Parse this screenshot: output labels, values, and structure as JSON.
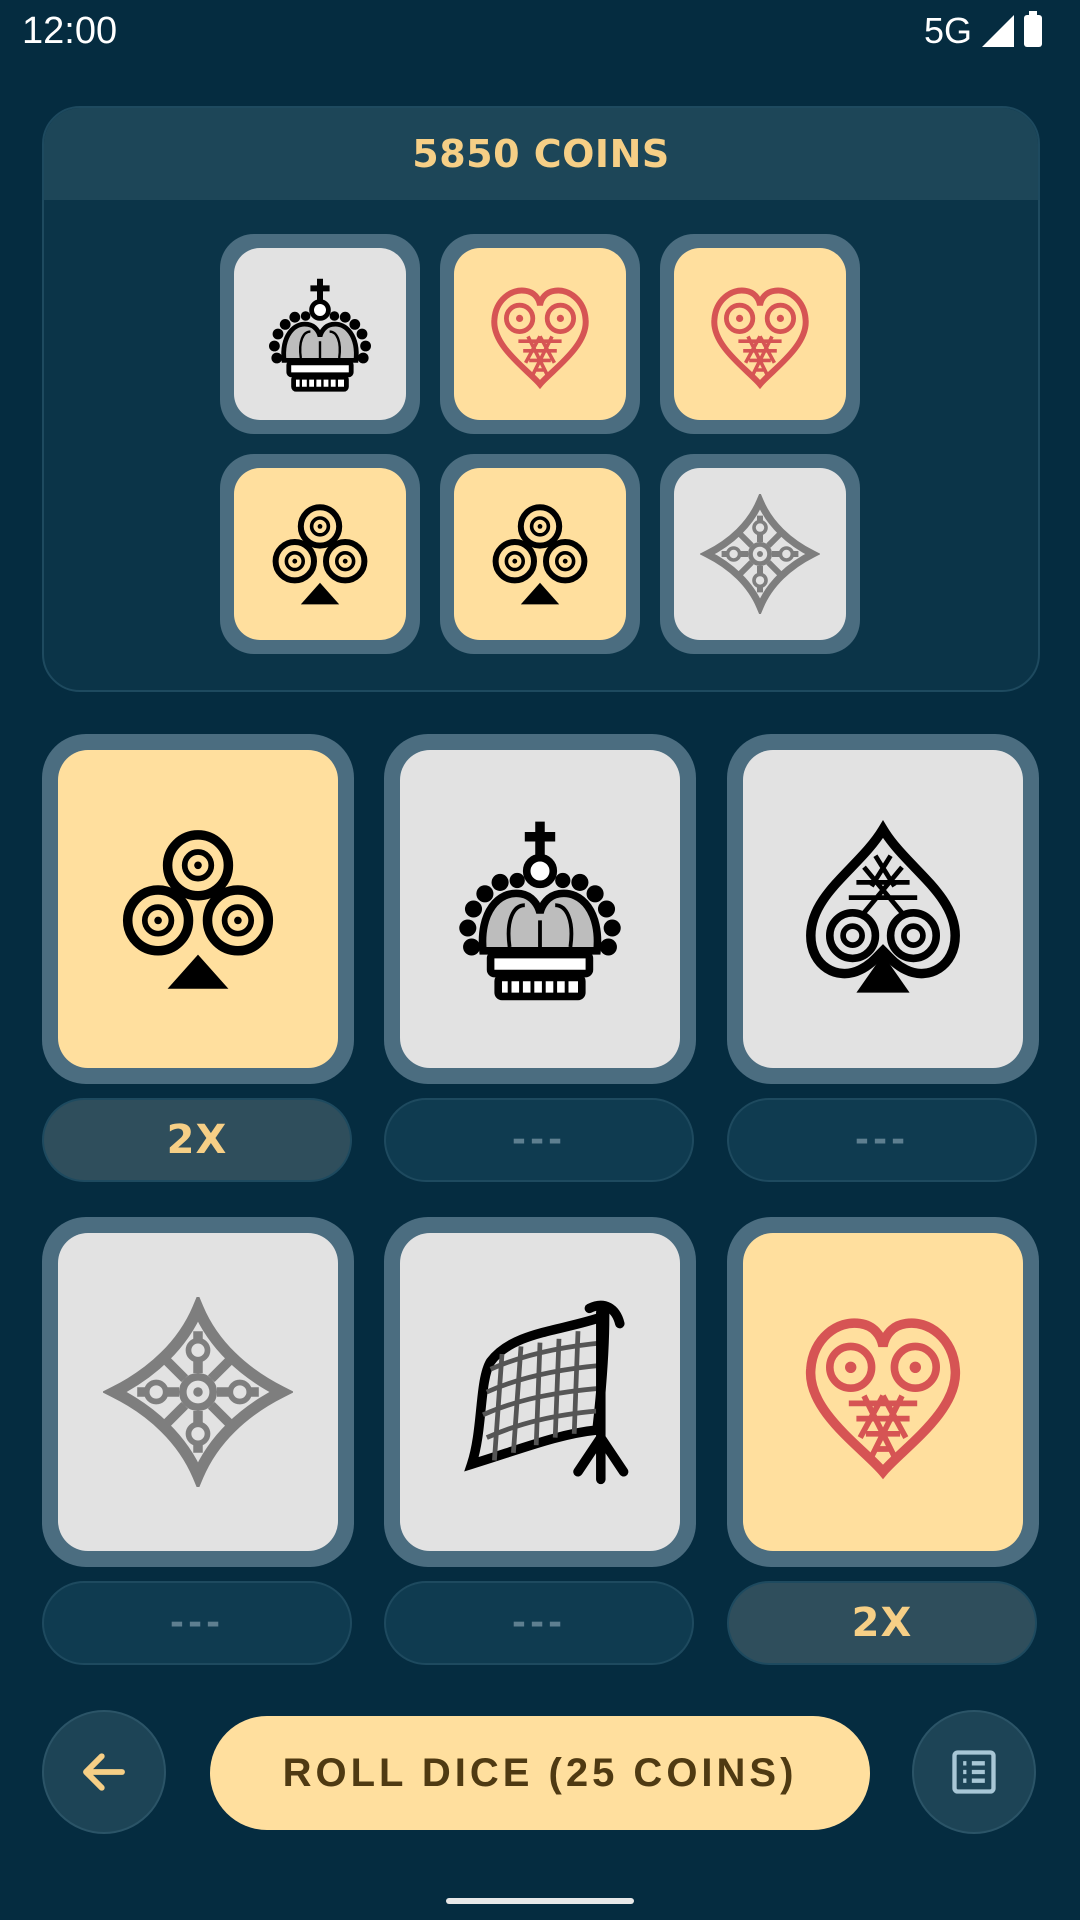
{
  "status": {
    "time": "12:00",
    "network": "5G"
  },
  "coins_label": "5850 COINS",
  "top_dice": [
    {
      "symbol": "crown-icon",
      "tone": "grey"
    },
    {
      "symbol": "heart-icon",
      "tone": "cream"
    },
    {
      "symbol": "heart-icon",
      "tone": "cream"
    },
    {
      "symbol": "club-icon",
      "tone": "cream"
    },
    {
      "symbol": "club-icon",
      "tone": "cream"
    },
    {
      "symbol": "diamond-icon",
      "tone": "grey"
    }
  ],
  "dice": [
    {
      "symbol": "club-icon",
      "tone": "cream",
      "multiplier": "2X"
    },
    {
      "symbol": "crown-icon",
      "tone": "grey",
      "multiplier": "---"
    },
    {
      "symbol": "spade-icon",
      "tone": "grey",
      "multiplier": "---"
    },
    {
      "symbol": "diamond-icon",
      "tone": "grey",
      "multiplier": "---"
    },
    {
      "symbol": "anchor-net-icon",
      "tone": "grey",
      "multiplier": "---"
    },
    {
      "symbol": "heart-icon",
      "tone": "cream",
      "multiplier": "2X"
    }
  ],
  "controls": {
    "back_icon": "arrow-left-icon",
    "roll_label": "ROLL DICE (25 COINS)",
    "list_icon": "list-icon"
  },
  "colors": {
    "background": "#052c40",
    "cream": "#ffdf9e",
    "grey": "#e2e2e2",
    "gold_text": "#f6cf86",
    "heart_red": "#d65454"
  }
}
